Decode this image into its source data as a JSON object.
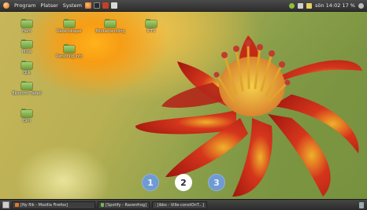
{
  "top_panel": {
    "menus": [
      "Program",
      "Platser",
      "System"
    ],
    "clock": "sön 14:02 17 %",
    "colors": {
      "network": "#3fae4f",
      "volume": "#d0d0d0",
      "battery": "#e8d060"
    }
  },
  "desktop_icons": [
    {
      "label": "Hem"
    },
    {
      "label": "Räkenskaper"
    },
    {
      "label": "Bildbehandling"
    },
    {
      "label": "IPTV"
    },
    {
      "label": "Mina"
    },
    {
      "label": "Personlig info"
    },
    {
      "label": "Olik"
    },
    {
      "label": "Ekonomi Tabell"
    },
    {
      "label": "Olm"
    }
  ],
  "workspaces": [
    {
      "label": "1",
      "active": false
    },
    {
      "label": "2",
      "active": true
    },
    {
      "label": "3",
      "active": false
    }
  ],
  "taskbar": [
    {
      "label": "[Ny flik - Mozilla Firefox]",
      "icon": "firefox-icon",
      "color": "#e07a24"
    },
    {
      "label": "[Spotify - Ravenfrog]",
      "icon": "spotify-icon",
      "color": "#72b84b"
    },
    {
      "label": "[ibbs - Ville-constOnT...]",
      "icon": "terminal-icon",
      "color": "#555555"
    }
  ]
}
